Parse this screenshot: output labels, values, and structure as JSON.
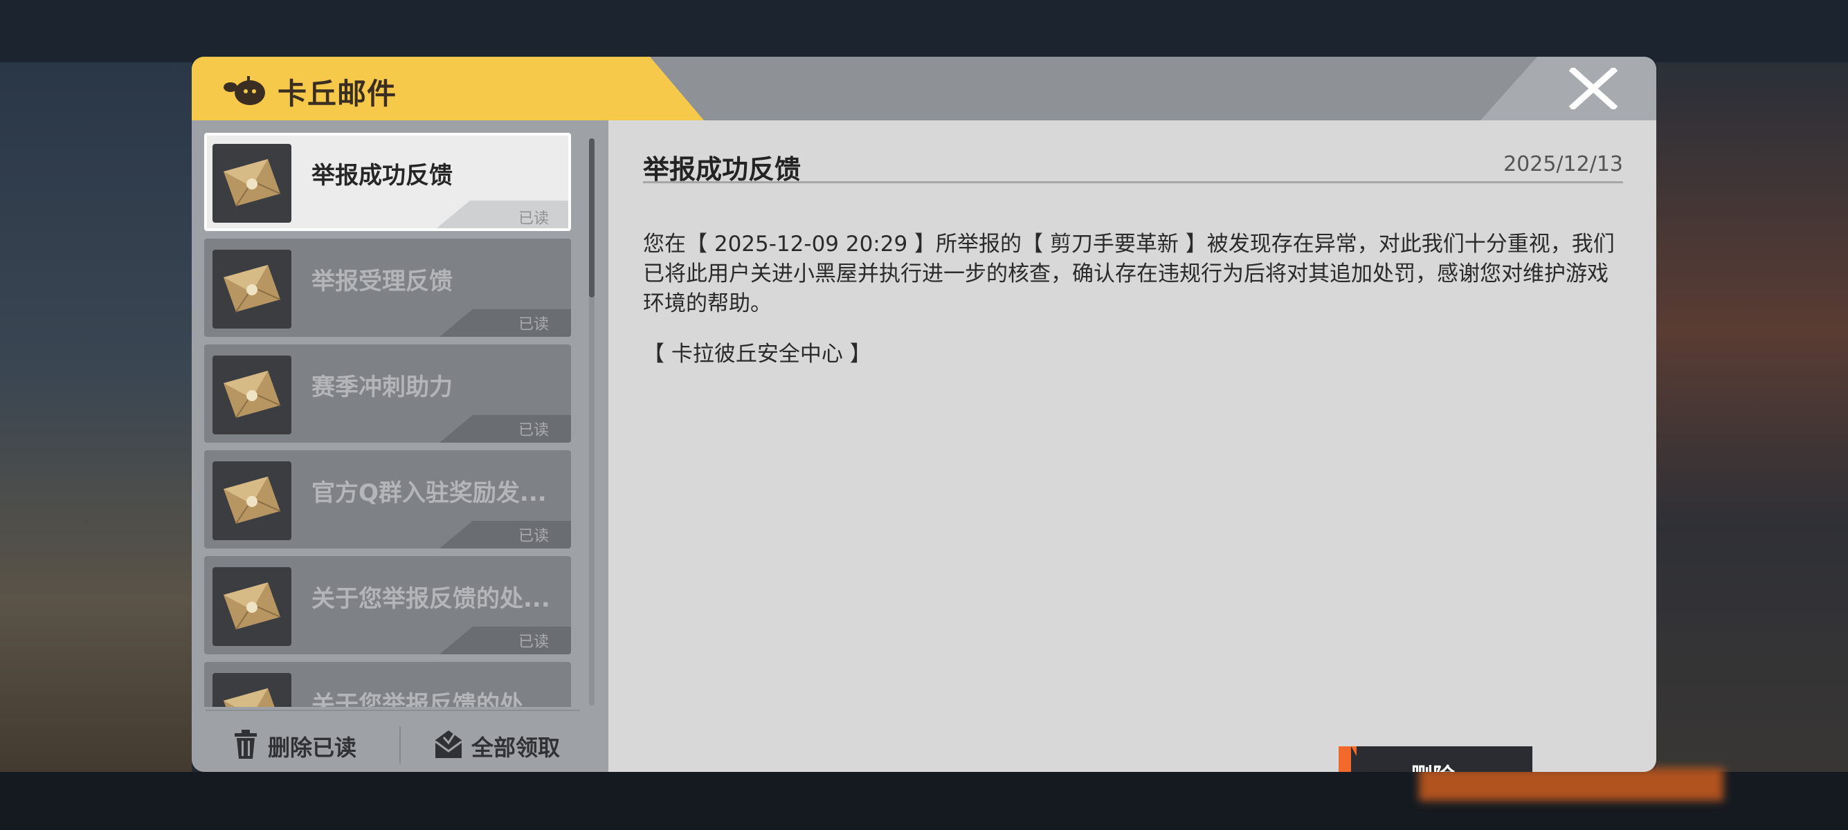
{
  "dialog": {
    "title": "卡丘邮件",
    "close_icon": "close-x-icon"
  },
  "mail_list": [
    {
      "title": "举报成功反馈",
      "status": "已读",
      "selected": true
    },
    {
      "title": "举报受理反馈",
      "status": "已读",
      "selected": false
    },
    {
      "title": "赛季冲刺助力",
      "status": "已读",
      "selected": false
    },
    {
      "title": "官方Q群入驻奖励发...",
      "status": "已读",
      "selected": false
    },
    {
      "title": "关于您举报反馈的处...",
      "status": "已读",
      "selected": false
    },
    {
      "title": "关于您举报反馈的处...",
      "status": "",
      "selected": false
    }
  ],
  "footer": {
    "delete_read_label": "删除已读",
    "claim_all_label": "全部领取"
  },
  "content": {
    "title": "举报成功反馈",
    "date": "2025/12/13",
    "body": "您在【 2025-12-09 20:29 】所举报的【 剪刀手要革新 】被发现存在异常，对此我们十分重视，我们已将此用户关进小黑屋并执行进一步的核查，确认存在违规行为后将对其追加处罚，感谢您对维护游戏环境的帮助。",
    "signature": "【 卡拉彼丘安全中心 】",
    "delete_label": "删除"
  },
  "colors": {
    "title_tab": "#f7c94a",
    "accent_orange": "#f26a2b",
    "panel_bg": "#d8d8d8"
  }
}
